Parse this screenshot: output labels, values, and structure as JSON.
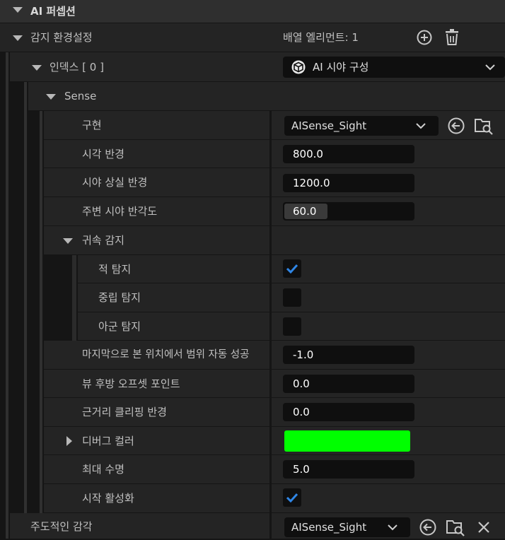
{
  "section": {
    "title": "AI 퍼셉션"
  },
  "senses_config": {
    "label": "감지 환경설정",
    "array_count": "배열 엘리먼트: 1",
    "index_label": "인덱스 [ 0 ]",
    "index_value": "AI 시야 구성",
    "sense_label": "Sense"
  },
  "props": {
    "implementation": {
      "label": "구현",
      "value": "AISense_Sight"
    },
    "sight_radius": {
      "label": "시각 반경",
      "value": "800.0"
    },
    "lose_sight_radius": {
      "label": "시야 상실 반경",
      "value": "1200.0"
    },
    "peripheral_angle": {
      "label": "주변 시야 반각도",
      "value": "60.0",
      "fill_fraction": 0.333
    },
    "affiliation": {
      "label": "귀속 감지"
    },
    "detect_enemies": {
      "label": "적 탐지",
      "checked": true
    },
    "detect_neutrals": {
      "label": "중립 탐지",
      "checked": false
    },
    "detect_friendlies": {
      "label": "아군 탐지",
      "checked": false
    },
    "auto_success": {
      "label": "마지막으로 본 위치에서 범위 자동 성공",
      "value": "-1.0"
    },
    "pov_backward_offset": {
      "label": "뷰 후방 오프셋 포인트",
      "value": "0.0"
    },
    "near_clipping": {
      "label": "근거리 클리핑 반경",
      "value": "0.0"
    },
    "debug_color": {
      "label": "디버그 컬러",
      "color": "#00ff00"
    },
    "max_age": {
      "label": "최대 수명",
      "value": "5.0"
    },
    "starts_enabled": {
      "label": "시작 활성화",
      "checked": true
    }
  },
  "dominant_sense": {
    "label": "주도적인 감각",
    "value": "AISense_Sight"
  },
  "colors": {
    "accent_check": "#2f86e6",
    "debug_green": "#00ff00"
  }
}
